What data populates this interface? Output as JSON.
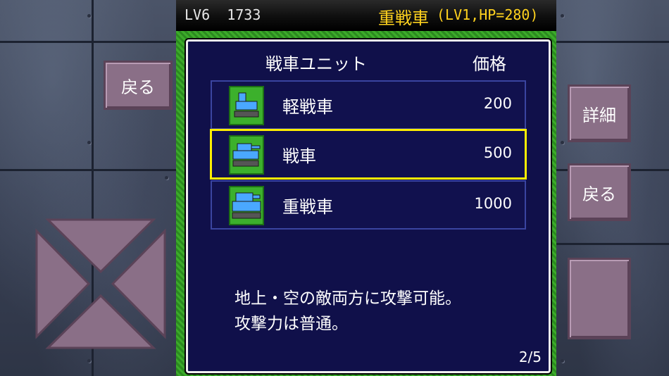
{
  "status_bar": {
    "level": "LV6",
    "money": "1733",
    "selected_unit_name": "重戦車",
    "selected_unit_stats": "(LV1,HP=280)"
  },
  "left_controls": {
    "back_label": "戻る"
  },
  "right_controls": {
    "detail_label": "詳細",
    "back_label": "戻る",
    "action_label": ""
  },
  "dialog": {
    "header_unit": "戦車ユニット",
    "header_price": "価格",
    "items": [
      {
        "label": "軽戦車",
        "price": "200",
        "icon": "light-tank-icon"
      },
      {
        "label": "戦車",
        "price": "500",
        "icon": "tank-icon"
      },
      {
        "label": "重戦車",
        "price": "1000",
        "icon": "heavy-tank-icon"
      }
    ],
    "selected_index": 1,
    "description_line1": "地上・空の敵両方に攻撃可能。",
    "description_line2": "攻撃力は普通。",
    "page": "2/5"
  },
  "colors": {
    "highlight": "#ffee00",
    "title_text": "#ffd21e",
    "dialog_bg": "#10104a",
    "button": "#8a6f87"
  }
}
